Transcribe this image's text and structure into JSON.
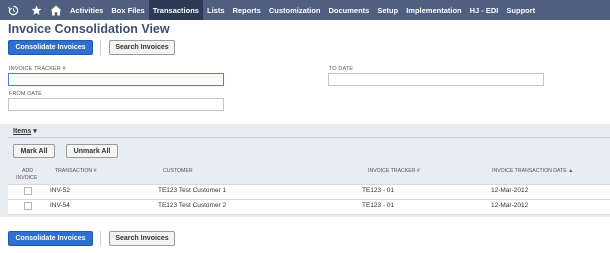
{
  "nav": {
    "items": [
      {
        "label": "Activities"
      },
      {
        "label": "Box Files"
      },
      {
        "label": "Transactions"
      },
      {
        "label": "Lists"
      },
      {
        "label": "Reports"
      },
      {
        "label": "Customization"
      },
      {
        "label": "Documents"
      },
      {
        "label": "Setup"
      },
      {
        "label": "Implementation"
      },
      {
        "label": "HJ - EDI"
      },
      {
        "label": "Support"
      }
    ],
    "active": "Transactions"
  },
  "page": {
    "title": "Invoice Consolidation View"
  },
  "toolbar": {
    "consolidate_label": "Consolidate Invoices",
    "search_label": "Search Invoices"
  },
  "form": {
    "invoice_tracker_label": "INVOICE TRACKER #",
    "invoice_tracker_value": "",
    "to_date_label": "TO DATE",
    "to_date_value": "",
    "from_date_label": "FROM DATE",
    "from_date_value": ""
  },
  "items": {
    "title": "Items",
    "mark_all_label": "Mark All",
    "unmark_all_label": "Unmark All",
    "columns": {
      "add_invoice_line1": "ADD",
      "add_invoice_line2": "INVOICE",
      "transaction": "TRANSACTION #",
      "customer": "CUSTOMER",
      "invoice_tracker": "INVOICE TRACKER #",
      "invoice_date": "INVOICE TRANSACTION DATE ▲"
    },
    "rows": [
      {
        "transaction": "INV-52",
        "customer": "TE123 Test Customer 1",
        "invoice_tracker": "TE123 - 01",
        "date": "12-Mar-2012",
        "checked": false
      },
      {
        "transaction": "INV-54",
        "customer": "TE123 Test Customer 2",
        "invoice_tracker": "TE123 - 01",
        "date": "12-Mar-2012",
        "checked": false
      }
    ]
  },
  "icons": {
    "history": "history-icon",
    "favorites": "star-icon",
    "home": "home-icon"
  },
  "colors": {
    "nav_bg": "#4f5f7f",
    "nav_active": "#2c3a55",
    "primary_button": "#2e6fd0",
    "title": "#3d4f70",
    "items_panel": "#e8ecf3"
  }
}
